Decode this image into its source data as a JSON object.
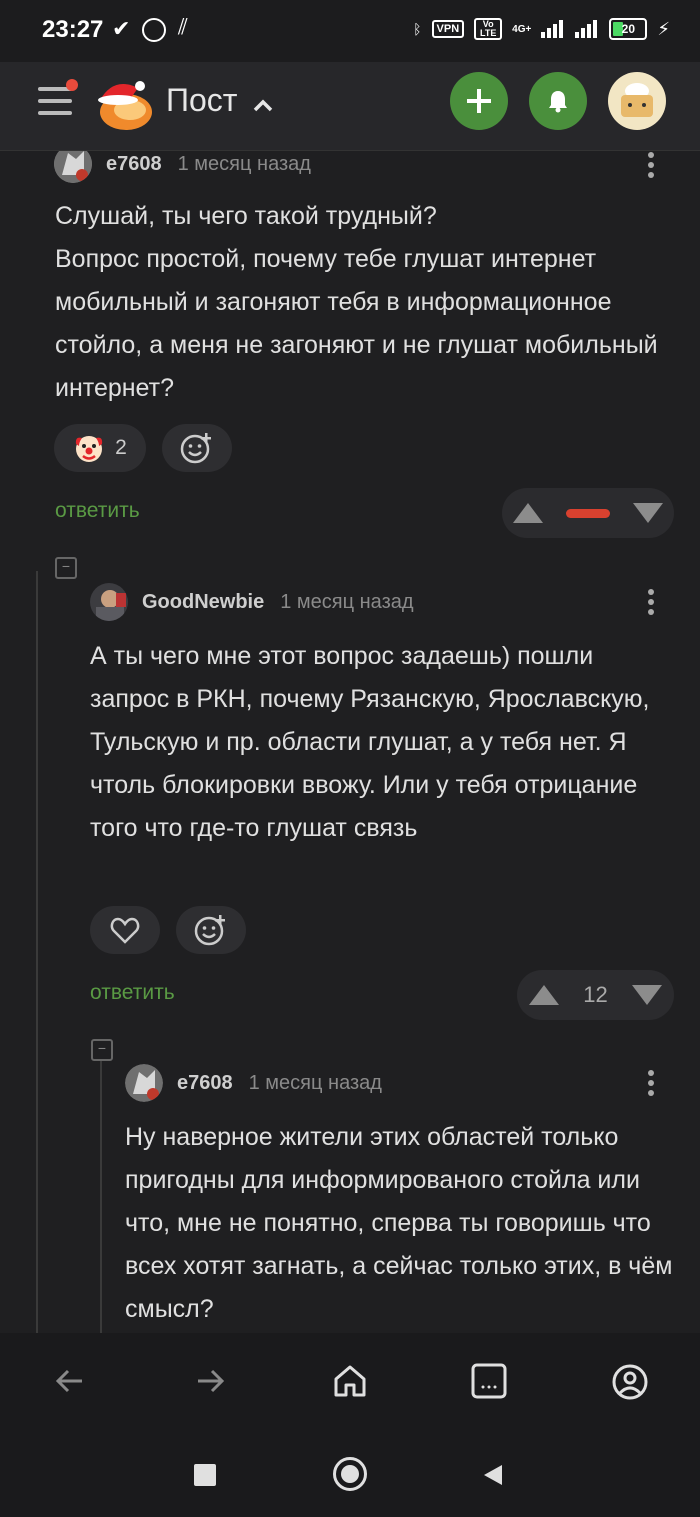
{
  "status_bar": {
    "time": "23:27",
    "vpn": "VPN",
    "volte": "Vo LTE",
    "network": "4G+",
    "battery": "20"
  },
  "header": {
    "title": "Пост",
    "chevron": "^"
  },
  "comments": [
    {
      "author": "e7608",
      "time": "1 месяц назад",
      "text": "Слушай, ты чего такой трудный?\nВопрос простой, почему тебе глушат интернет мобильный и загоняют тебя в информационное стойло, а меня не загоняют и не глушат мобильный интернет?",
      "reaction_count": "2",
      "reply_label": "ответить",
      "rating": ""
    },
    {
      "author": "GoodNewbie",
      "time": "1 месяц назад",
      "text": "А ты чего мне этот вопрос задаешь) пошли запрос в РКН, почему Рязанскую, Ярославскую, Тульскую и пр. области глушат, а у тебя нет. Я чтоль блокировки ввожу. Или у тебя отрицание того что где-то глушат связь",
      "reply_label": "ответить",
      "rating": "12"
    },
    {
      "author": "e7608",
      "time": "1 месяц назад",
      "text": "Ну наверное жители этих областей только пригодны для информированого стойла или что, мне не понятно, сперва ты говоришь что всех хотят загнать, а сейчас только этих, в чём смысл?"
    }
  ],
  "colors": {
    "accent": "#4a8f3c",
    "reply": "#5a9a44",
    "negative_bar": "#d9412f",
    "background": "#1f1f21"
  },
  "icons": [
    "hamburger-icon",
    "plus-icon",
    "bell-icon",
    "clown-emoji-icon",
    "add-reaction-icon",
    "heart-icon",
    "arrow-up-icon",
    "arrow-down-icon",
    "back-icon",
    "forward-icon",
    "home-icon",
    "tabs-icon",
    "profile-icon"
  ]
}
